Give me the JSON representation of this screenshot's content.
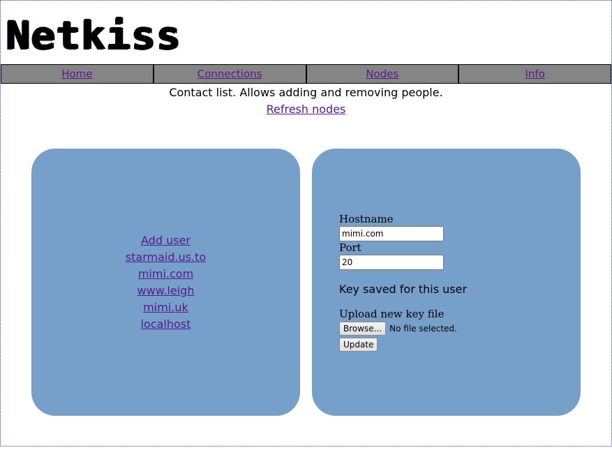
{
  "logo": "Netkiss",
  "nav": {
    "home": "Home",
    "connections": "Connections",
    "nodes": "Nodes",
    "info": "Info"
  },
  "page": {
    "subtitle": "Contact list. Allows adding and removing people.",
    "refresh_link": "Refresh nodes"
  },
  "users": {
    "add_user": "Add user",
    "items": [
      "starmaid.us.to",
      "mimi.com",
      "www.leigh",
      "mimi.uk",
      "localhost"
    ]
  },
  "form": {
    "hostname_label": "Hostname",
    "hostname_value": "mimi.com",
    "port_label": "Port",
    "port_value": "20",
    "key_status": "Key saved for this user",
    "upload_label": "Upload new key file",
    "browse_label": "Browse...",
    "file_status": "No file selected.",
    "update_label": "Update"
  },
  "colors": {
    "panel": "#76a0c9",
    "nav_bg": "#858585",
    "link": "#551a8b"
  }
}
